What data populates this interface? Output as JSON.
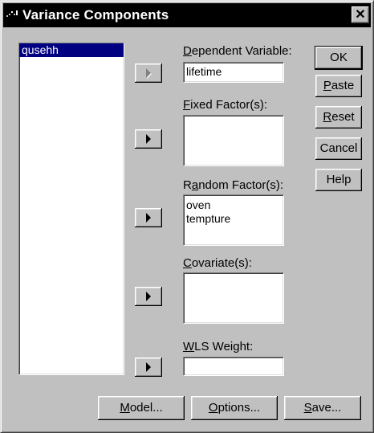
{
  "window": {
    "title": "Variance Components",
    "close_label": "✕"
  },
  "source_list": {
    "items": [
      "qusehh"
    ],
    "selected": "qusehh"
  },
  "dependent": {
    "label_mnemonic": "D",
    "label_rest": "ependent Variable:",
    "value": "lifetime"
  },
  "fixed": {
    "label_mnemonic": "F",
    "label_rest": "ixed Factor(s):",
    "items": []
  },
  "random": {
    "label_pre": "R",
    "label_mnemonic": "a",
    "label_rest": "ndom Factor(s):",
    "items": [
      "oven",
      "tempture"
    ]
  },
  "covariate": {
    "label_mnemonic": "C",
    "label_rest": "ovariate(s):",
    "items": []
  },
  "wls": {
    "label_mnemonic": "W",
    "label_rest": "LS Weight:",
    "value": ""
  },
  "buttons": {
    "ok": "OK",
    "paste_mnemonic": "P",
    "paste_rest": "aste",
    "reset_mnemonic": "R",
    "reset_rest": "eset",
    "cancel": "Cancel",
    "help": "Help",
    "model_mnemonic": "M",
    "model_rest": "odel...",
    "options_mnemonic": "O",
    "options_rest": "ptions...",
    "save_mnemonic": "S",
    "save_rest": "ave..."
  }
}
